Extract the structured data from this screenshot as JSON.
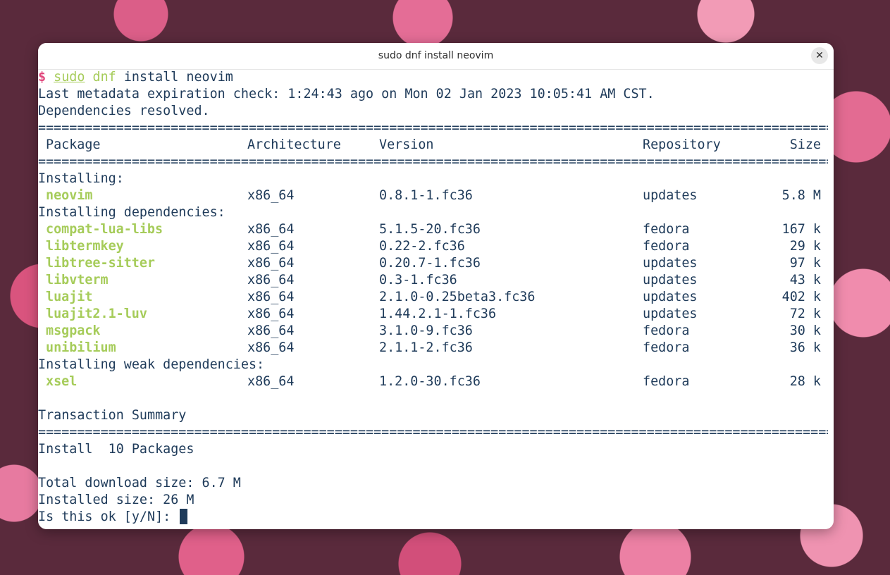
{
  "window": {
    "title": "sudo dnf install neovim",
    "close_icon": "✕"
  },
  "terminal": {
    "prompt_symbol": "$",
    "cmd_sudo": "sudo",
    "cmd_dnf": "dnf",
    "cmd_rest": "install neovim",
    "metadata_line": "Last metadata expiration check: 1:24:43 ago on Mon 02 Jan 2023 10:05:41 AM CST.",
    "deps_resolved": "Dependencies resolved.",
    "separator": "=================================================================================================================================================",
    "headers": {
      "package": "Package",
      "arch": "Architecture",
      "version": "Version",
      "repo": "Repository",
      "size": "Size"
    },
    "sections": {
      "installing": "Installing:",
      "installing_deps": "Installing dependencies:",
      "installing_weak": "Installing weak dependencies:"
    },
    "rows": [
      {
        "name": "neovim",
        "arch": "x86_64",
        "version": "0.8.1-1.fc36",
        "repo": "updates",
        "size": "5.8 M"
      },
      {
        "name": "compat-lua-libs",
        "arch": "x86_64",
        "version": "5.1.5-20.fc36",
        "repo": "fedora",
        "size": "167 k"
      },
      {
        "name": "libtermkey",
        "arch": "x86_64",
        "version": "0.22-2.fc36",
        "repo": "fedora",
        "size": "29 k"
      },
      {
        "name": "libtree-sitter",
        "arch": "x86_64",
        "version": "0.20.7-1.fc36",
        "repo": "updates",
        "size": "97 k"
      },
      {
        "name": "libvterm",
        "arch": "x86_64",
        "version": "0.3-1.fc36",
        "repo": "updates",
        "size": "43 k"
      },
      {
        "name": "luajit",
        "arch": "x86_64",
        "version": "2.1.0-0.25beta3.fc36",
        "repo": "updates",
        "size": "402 k"
      },
      {
        "name": "luajit2.1-luv",
        "arch": "x86_64",
        "version": "1.44.2.1-1.fc36",
        "repo": "updates",
        "size": "72 k"
      },
      {
        "name": "msgpack",
        "arch": "x86_64",
        "version": "3.1.0-9.fc36",
        "repo": "fedora",
        "size": "30 k"
      },
      {
        "name": "unibilium",
        "arch": "x86_64",
        "version": "2.1.1-2.fc36",
        "repo": "fedora",
        "size": "36 k"
      },
      {
        "name": "xsel",
        "arch": "x86_64",
        "version": "1.2.0-30.fc36",
        "repo": "fedora",
        "size": "28 k"
      }
    ],
    "summary_title": "Transaction Summary",
    "install_summary": "Install  10 Packages",
    "total_download": "Total download size: 6.7 M",
    "installed_size": "Installed size: 26 M",
    "confirm_prompt": "Is this ok [y/N]: "
  },
  "colors": {
    "text": "#1f3b5a",
    "prompt": "#e0457b",
    "package": "#a6cc5a"
  }
}
